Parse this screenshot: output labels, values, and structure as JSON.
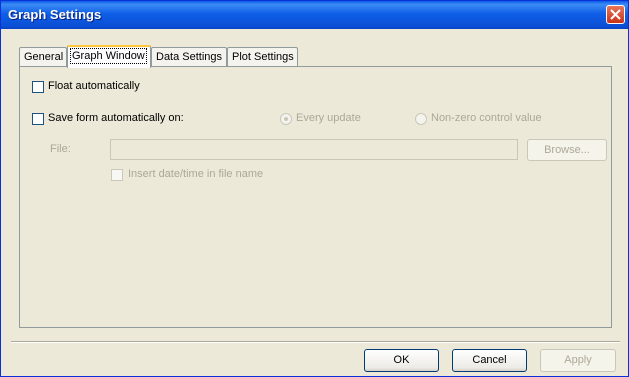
{
  "window": {
    "title": "Graph Settings",
    "title_color": "#ffffff",
    "titlebar_color": "#0a5ae8",
    "body_color": "#ece9d8"
  },
  "tabs": [
    {
      "label": "General",
      "active": false
    },
    {
      "label": "Graph Window",
      "active": true
    },
    {
      "label": "Data Settings",
      "active": false
    },
    {
      "label": "Plot Settings",
      "active": false
    }
  ],
  "panel": {
    "float_automatically": {
      "label": "Float automatically",
      "checked": false
    },
    "save_form": {
      "label": "Save form automatically on:",
      "checked": false
    },
    "radio_every_update": {
      "label": "Every update",
      "selected": true,
      "enabled": false
    },
    "radio_nonzero": {
      "label": "Non-zero control value",
      "selected": false,
      "enabled": false
    },
    "file": {
      "label": "File:",
      "value": "",
      "enabled": false
    },
    "browse_label": "Browse...",
    "insert_datetime": {
      "label": "Insert date/time in file name",
      "checked": false,
      "enabled": false
    }
  },
  "buttons": {
    "ok": "OK",
    "cancel": "Cancel",
    "apply": "Apply"
  },
  "icons": {
    "close": "close-icon"
  }
}
